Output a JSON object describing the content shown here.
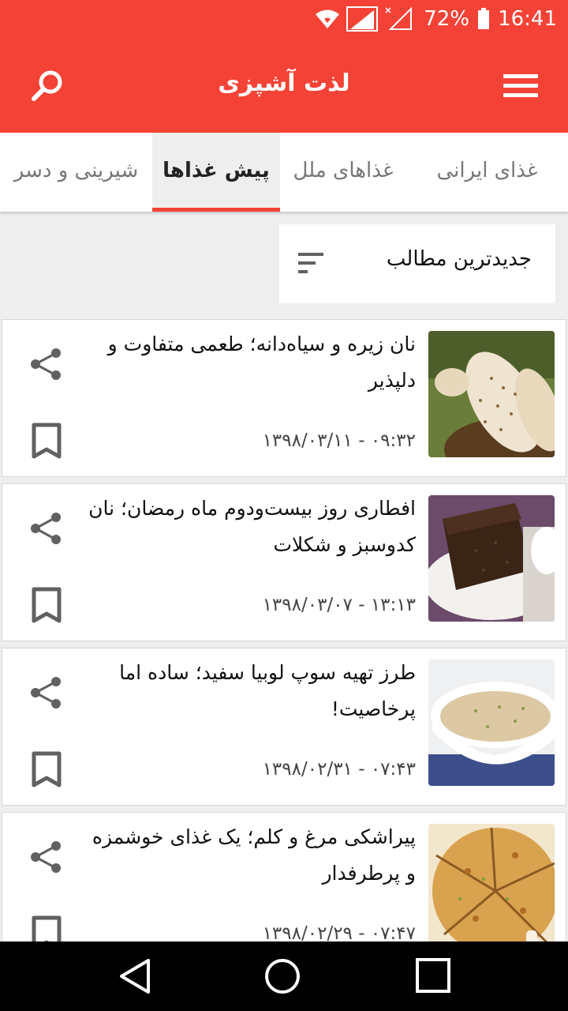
{
  "status_bar": {
    "battery": "72%",
    "time": "16:41",
    "icons": [
      "wifi-icon",
      "signal-sim1-icon",
      "signal-sim2-icon",
      "battery-icon"
    ]
  },
  "app_bar": {
    "title": "لذت آشپزی",
    "icons": [
      "menu-icon",
      "search-icon"
    ]
  },
  "tabs": [
    {
      "label": "غذای ایرانی",
      "active": false
    },
    {
      "label": "غذاهای ملل",
      "active": false
    },
    {
      "label": "پیش غذاها",
      "active": true
    },
    {
      "label": "شیرینی و دسر",
      "active": false
    }
  ],
  "sort": {
    "label": "جدیدترین مطالب",
    "icon": "sort-icon"
  },
  "articles": [
    {
      "title": "نان زیره و سیاه‌دانه؛ طعمی متفاوت و دلپذیر",
      "date": "۱۳۹۸/۰۳/۱۱ - ۰۹:۳۲"
    },
    {
      "title": "افطاری روز بیست‌ودوم ماه رمضان؛ نان کدوسبز و شکلات",
      "date": "۱۳۹۸/۰۳/۰۷ - ۱۳:۱۳"
    },
    {
      "title": "طرز تهیه سوپ لوبیا سفید؛ ساده اما پرخاصیت!",
      "date": "۱۳۹۸/۰۲/۳۱ - ۰۷:۴۳"
    },
    {
      "title": "پیراشکی مرغ و کلم؛ یک غذای خوشمزه و پرطرفدار",
      "date": "۱۳۹۸/۰۲/۲۹ - ۰۷:۴۷"
    }
  ],
  "colors": {
    "primary": "#f44336",
    "background": "#eeeeee",
    "icon_gray": "#616161"
  }
}
